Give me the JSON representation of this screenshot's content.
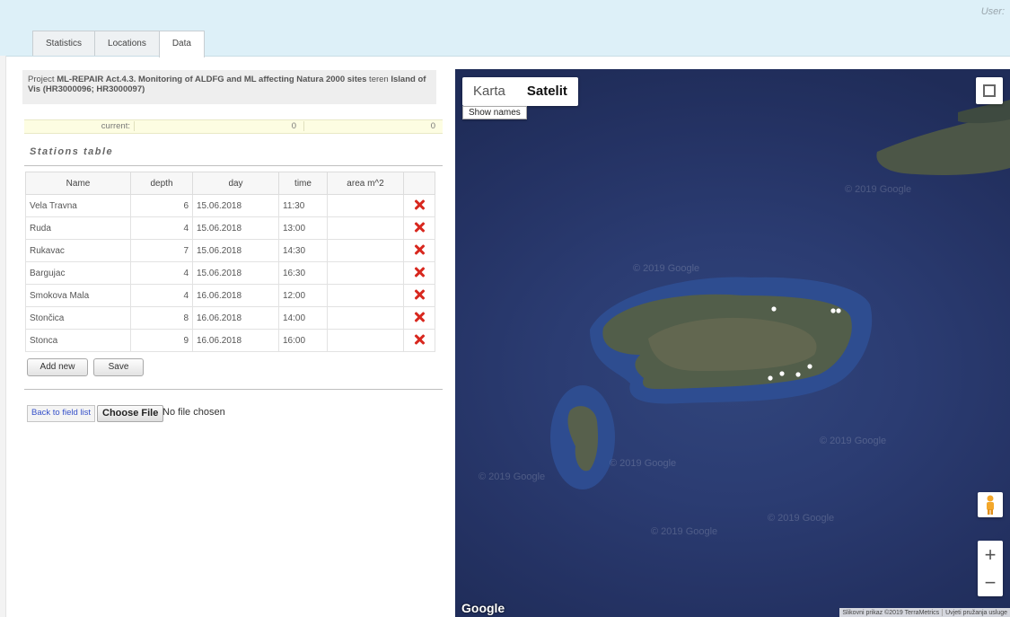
{
  "header": {
    "user_label": "User:"
  },
  "tabs": [
    {
      "label": "Statistics"
    },
    {
      "label": "Locations"
    },
    {
      "label": "Data"
    }
  ],
  "project": {
    "prefix": "Project ",
    "name": "ML-REPAIR Act.4.3. Monitoring of ALDFG and ML affecting Natura 2000 sites",
    "middle": " teren ",
    "location": "Island of Vis (HR3000096; HR3000097)"
  },
  "current": {
    "label": "current:",
    "value1": "0",
    "value2": "0"
  },
  "stations": {
    "title": "Stations table",
    "columns": [
      "Name",
      "depth",
      "day",
      "time",
      "area m^2"
    ],
    "rows": [
      {
        "name": "Vela Travna",
        "depth": "6",
        "day": "15.06.2018",
        "time": "11:30",
        "area": ""
      },
      {
        "name": "Ruda",
        "depth": "4",
        "day": "15.06.2018",
        "time": "13:00",
        "area": ""
      },
      {
        "name": "Rukavac",
        "depth": "7",
        "day": "15.06.2018",
        "time": "14:30",
        "area": ""
      },
      {
        "name": "Bargujac",
        "depth": "4",
        "day": "15.06.2018",
        "time": "16:30",
        "area": ""
      },
      {
        "name": "Smokova Mala",
        "depth": "4",
        "day": "16.06.2018",
        "time": "12:00",
        "area": ""
      },
      {
        "name": "Stončica",
        "depth": "8",
        "day": "16.06.2018",
        "time": "14:00",
        "area": ""
      },
      {
        "name": "Stonca",
        "depth": "9",
        "day": "16.06.2018",
        "time": "16:00",
        "area": ""
      }
    ]
  },
  "buttons": {
    "add_new": "Add new",
    "save": "Save",
    "back": "Back to field list",
    "choose_file": "Choose File",
    "no_file": "No file chosen"
  },
  "map": {
    "type_map": "Karta",
    "type_satellite": "Satelit",
    "show_names": "Show names",
    "logo": "Google",
    "watermark": "© 2019 Google",
    "attribution": "Slikovni prikaz ©2019 TerraMetrics",
    "terms": "Uvjeti pružanja usluge",
    "zoom_in": "+",
    "zoom_out": "−"
  }
}
